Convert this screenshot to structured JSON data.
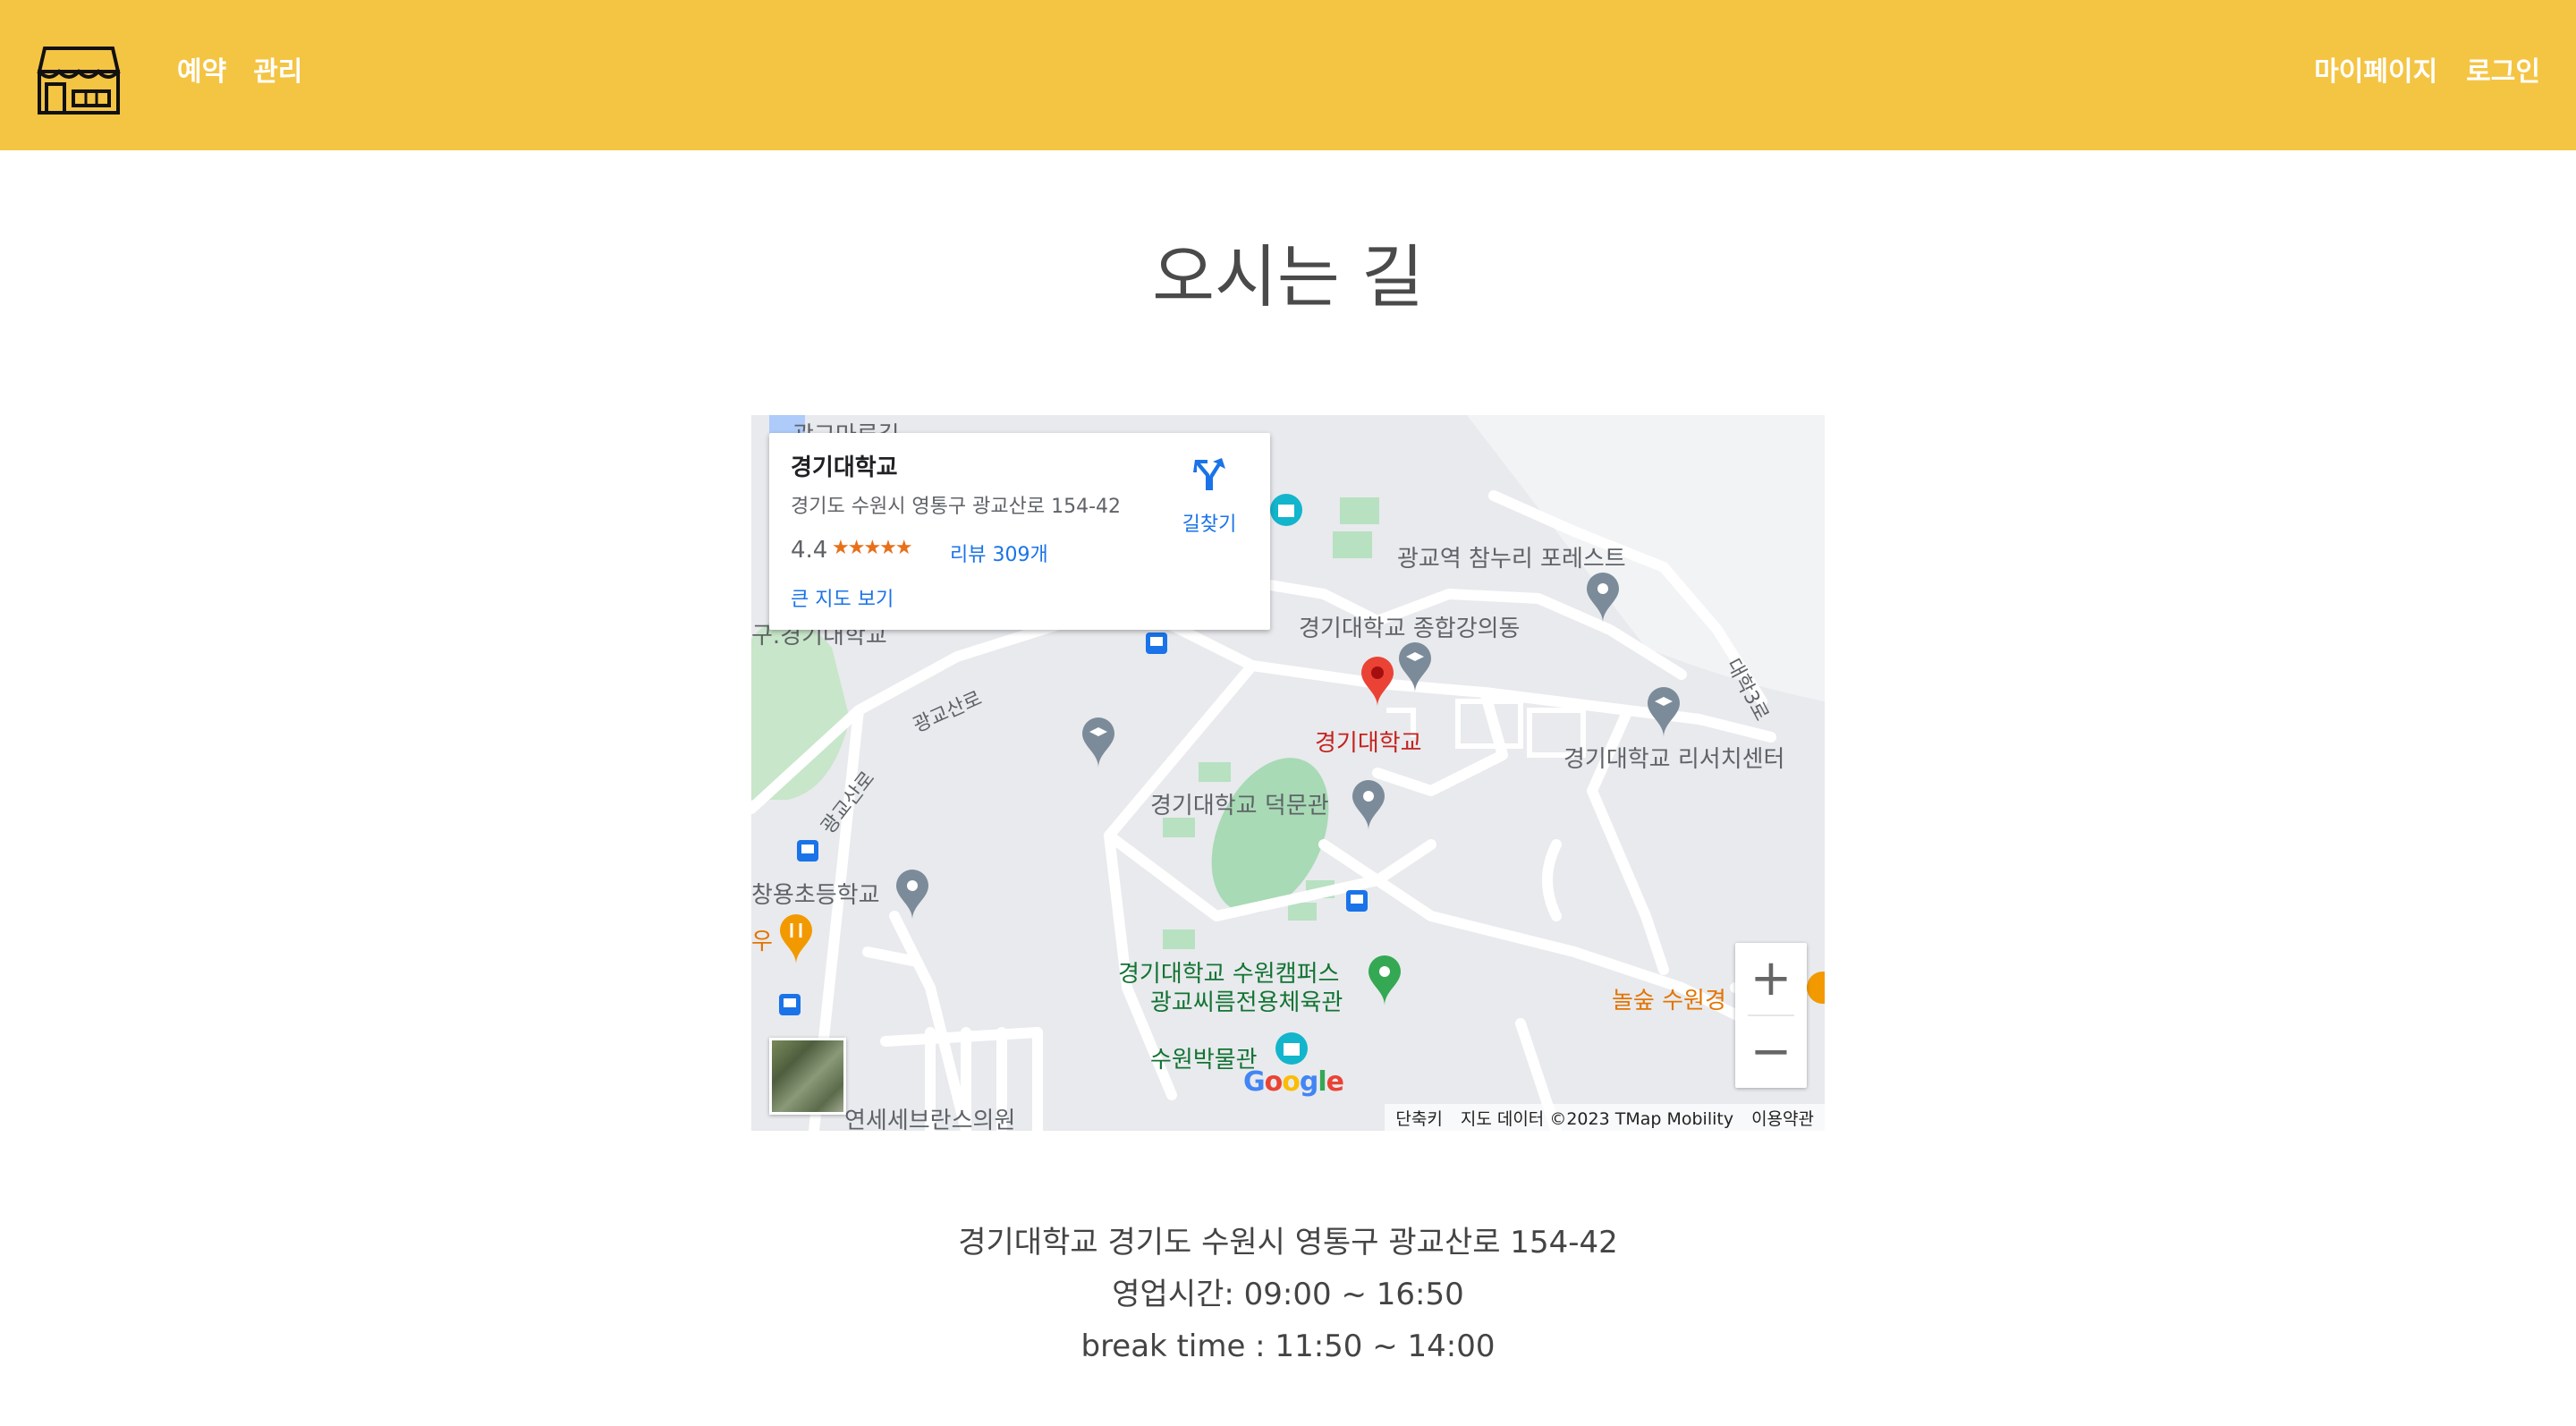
{
  "header": {
    "logo_icon": "store-icon",
    "nav_left": [
      "예약",
      "관리"
    ],
    "nav_right": [
      "마이페이지",
      "로그인"
    ],
    "background_color": "#f4c443"
  },
  "page_title": "오시는 길",
  "map": {
    "info_card": {
      "place_name": "경기대학교",
      "address": "경기도 수원시 영통구 광교산로 154-42",
      "rating": "4.4",
      "stars": "★★★★★",
      "reviews_link": "리뷰 309개",
      "directions_label": "길찾기",
      "larger_map_link": "큰 지도 보기"
    },
    "labels": {
      "top_cutoff": "광교마루길",
      "cutoff_left": "구.경기대학교",
      "apartment": "광교역 참누리 포레스트",
      "lecture_hall": "경기대학교 종합강의동",
      "main_pin": "경기대학교",
      "research_center": "경기대학교 리서치센터",
      "deokmun_hall": "경기대학교 덕문관",
      "elementary": "창용초등학교",
      "restaurant_cut": "우",
      "campus": "경기대학교 수원캠퍼스",
      "gym": "광교씨름전용체육관",
      "museum": "수원박물관",
      "forest": "놀숲 수원경",
      "clinic": "연세세브란스의원",
      "road_gwanggyosan": "광교산로",
      "road_gwanggyosan2": "광교산로",
      "road_daehak": "대학3로"
    },
    "google_logo": "Google",
    "attribution": {
      "shortcuts": "단축키",
      "data": "지도 데이터 ©2023 TMap Mobility",
      "terms": "이용약관"
    },
    "zoom_in": "+",
    "zoom_out": "−"
  },
  "details": {
    "address_line": "경기대학교 경기도 수원시 영통구 광교산로 154-42",
    "hours_line": "영업시간: 09:00 ~ 16:50",
    "break_line": "break time : 11:50 ~ 14:00"
  }
}
